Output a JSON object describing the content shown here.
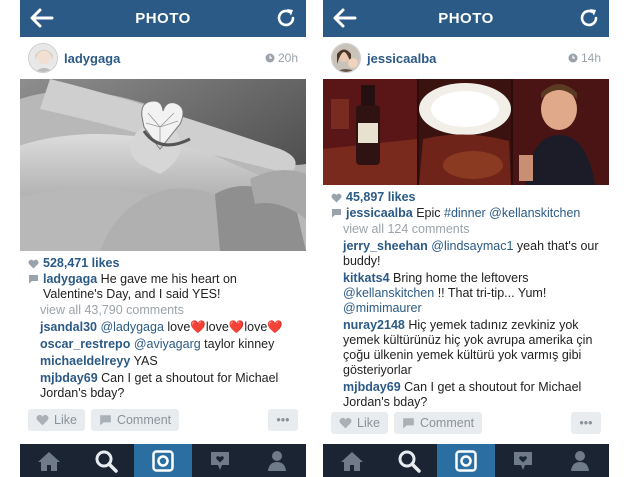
{
  "screens": [
    {
      "header": {
        "title": "PHOTO"
      },
      "post": {
        "username": "ladygaga",
        "time": "20h",
        "likes": "528,471 likes",
        "caption": {
          "user": "ladygaga",
          "text": "He gave me his heart on Valentine's Day, and I said YES!"
        },
        "view_all": "view all 43,790 comments",
        "comments": [
          {
            "user": "jsandal30",
            "mention": "@ladygaga",
            "text": " love❤️love❤️love❤️"
          },
          {
            "user": "oscar_restrepo",
            "mention": "@aviyagarg",
            "text": " taylor kinney"
          },
          {
            "user": "michaeldelreyy",
            "mention": "",
            "text": " YAS"
          },
          {
            "user": "mjbday69",
            "mention": "",
            "text": " Can I get a shoutout for Michael Jordan's bday?"
          }
        ]
      },
      "actions": {
        "like": "Like",
        "comment": "Comment",
        "more": "•••"
      }
    },
    {
      "header": {
        "title": "PHOTO"
      },
      "post": {
        "username": "jessicaalba",
        "time": "14h",
        "likes": "45,897 likes",
        "caption": {
          "user": "jessicaalba",
          "text": "Epic",
          "tags": " #dinner @kellanskitchen"
        },
        "view_all": "view all 124 comments",
        "comments": [
          {
            "user": "jerry_sheehan",
            "mention": "@lindsaymac1",
            "text": " yeah that's our buddy!"
          },
          {
            "user": "kitkats4",
            "mention": "",
            "text": " Bring home the leftovers ",
            "mention2": "@kellanskitchen",
            "text2": " !! That tri-tip... Yum! ",
            "mention3": "@mimimaurer"
          },
          {
            "user": "nuray2148",
            "mention": "",
            "text": " Hiç yemek tadınız zevkiniz yok yemek kültürünüz hiç yok avrupa amerika çin çoğu ülkenin yemek kültürü yok varmış gibi gösteriyorlar"
          },
          {
            "user": "mjbday69",
            "mention": "",
            "text": " Can I get a shoutout for Michael Jordan's bday?"
          }
        ]
      },
      "actions": {
        "like": "Like",
        "comment": "Comment",
        "more": "•••"
      }
    }
  ],
  "tabs": [
    "home-icon",
    "search-icon",
    "camera-icon",
    "activity-icon",
    "profile-icon"
  ],
  "active_tab": 2,
  "colors": {
    "header": "#2b5a86",
    "tabbar": "#1a2432",
    "active_tab": "#2b6ea2",
    "link": "#2b5a86",
    "muted": "#9aa3ab"
  }
}
